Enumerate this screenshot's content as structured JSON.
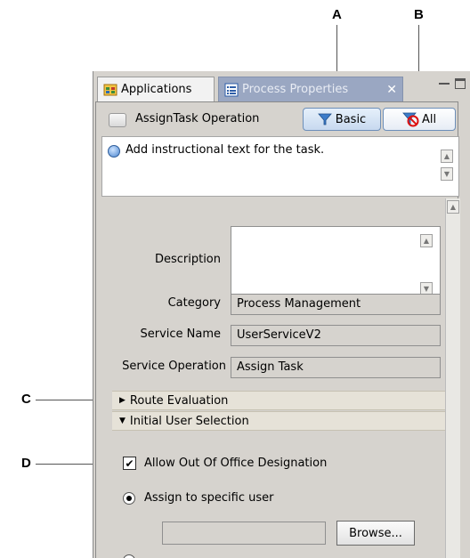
{
  "callouts": {
    "a": "A",
    "b": "B",
    "c": "C",
    "d": "D"
  },
  "tabs": {
    "applications": "Applications",
    "process_properties": "Process Properties"
  },
  "header": {
    "operation_title": "AssignTask Operation",
    "basic_label": "Basic",
    "all_label": "All"
  },
  "instruction": {
    "text": "Add instructional text for the task."
  },
  "fields": {
    "description_label": "Description",
    "description_value": "",
    "category_label": "Category",
    "category_value": "Process Management",
    "service_name_label": "Service Name",
    "service_name_value": "UserServiceV2",
    "service_operation_label": "Service Operation",
    "service_operation_value": "Assign Task"
  },
  "sections": {
    "route_evaluation": "Route Evaluation",
    "initial_user_selection": "Initial User Selection"
  },
  "options": {
    "allow_out_of_office": "Allow Out Of Office Designation",
    "allow_out_of_office_checked": true,
    "assign_specific_user": "Assign to specific user",
    "assign_specific_user_selected": true,
    "browse_label": "Browse...",
    "user_value": ""
  },
  "colors": {
    "panel_bg": "#d6d3ce",
    "active_tab_bg": "#9aa7c2",
    "section_bg": "#e6e2d8",
    "button_border": "#6d8fb9"
  }
}
